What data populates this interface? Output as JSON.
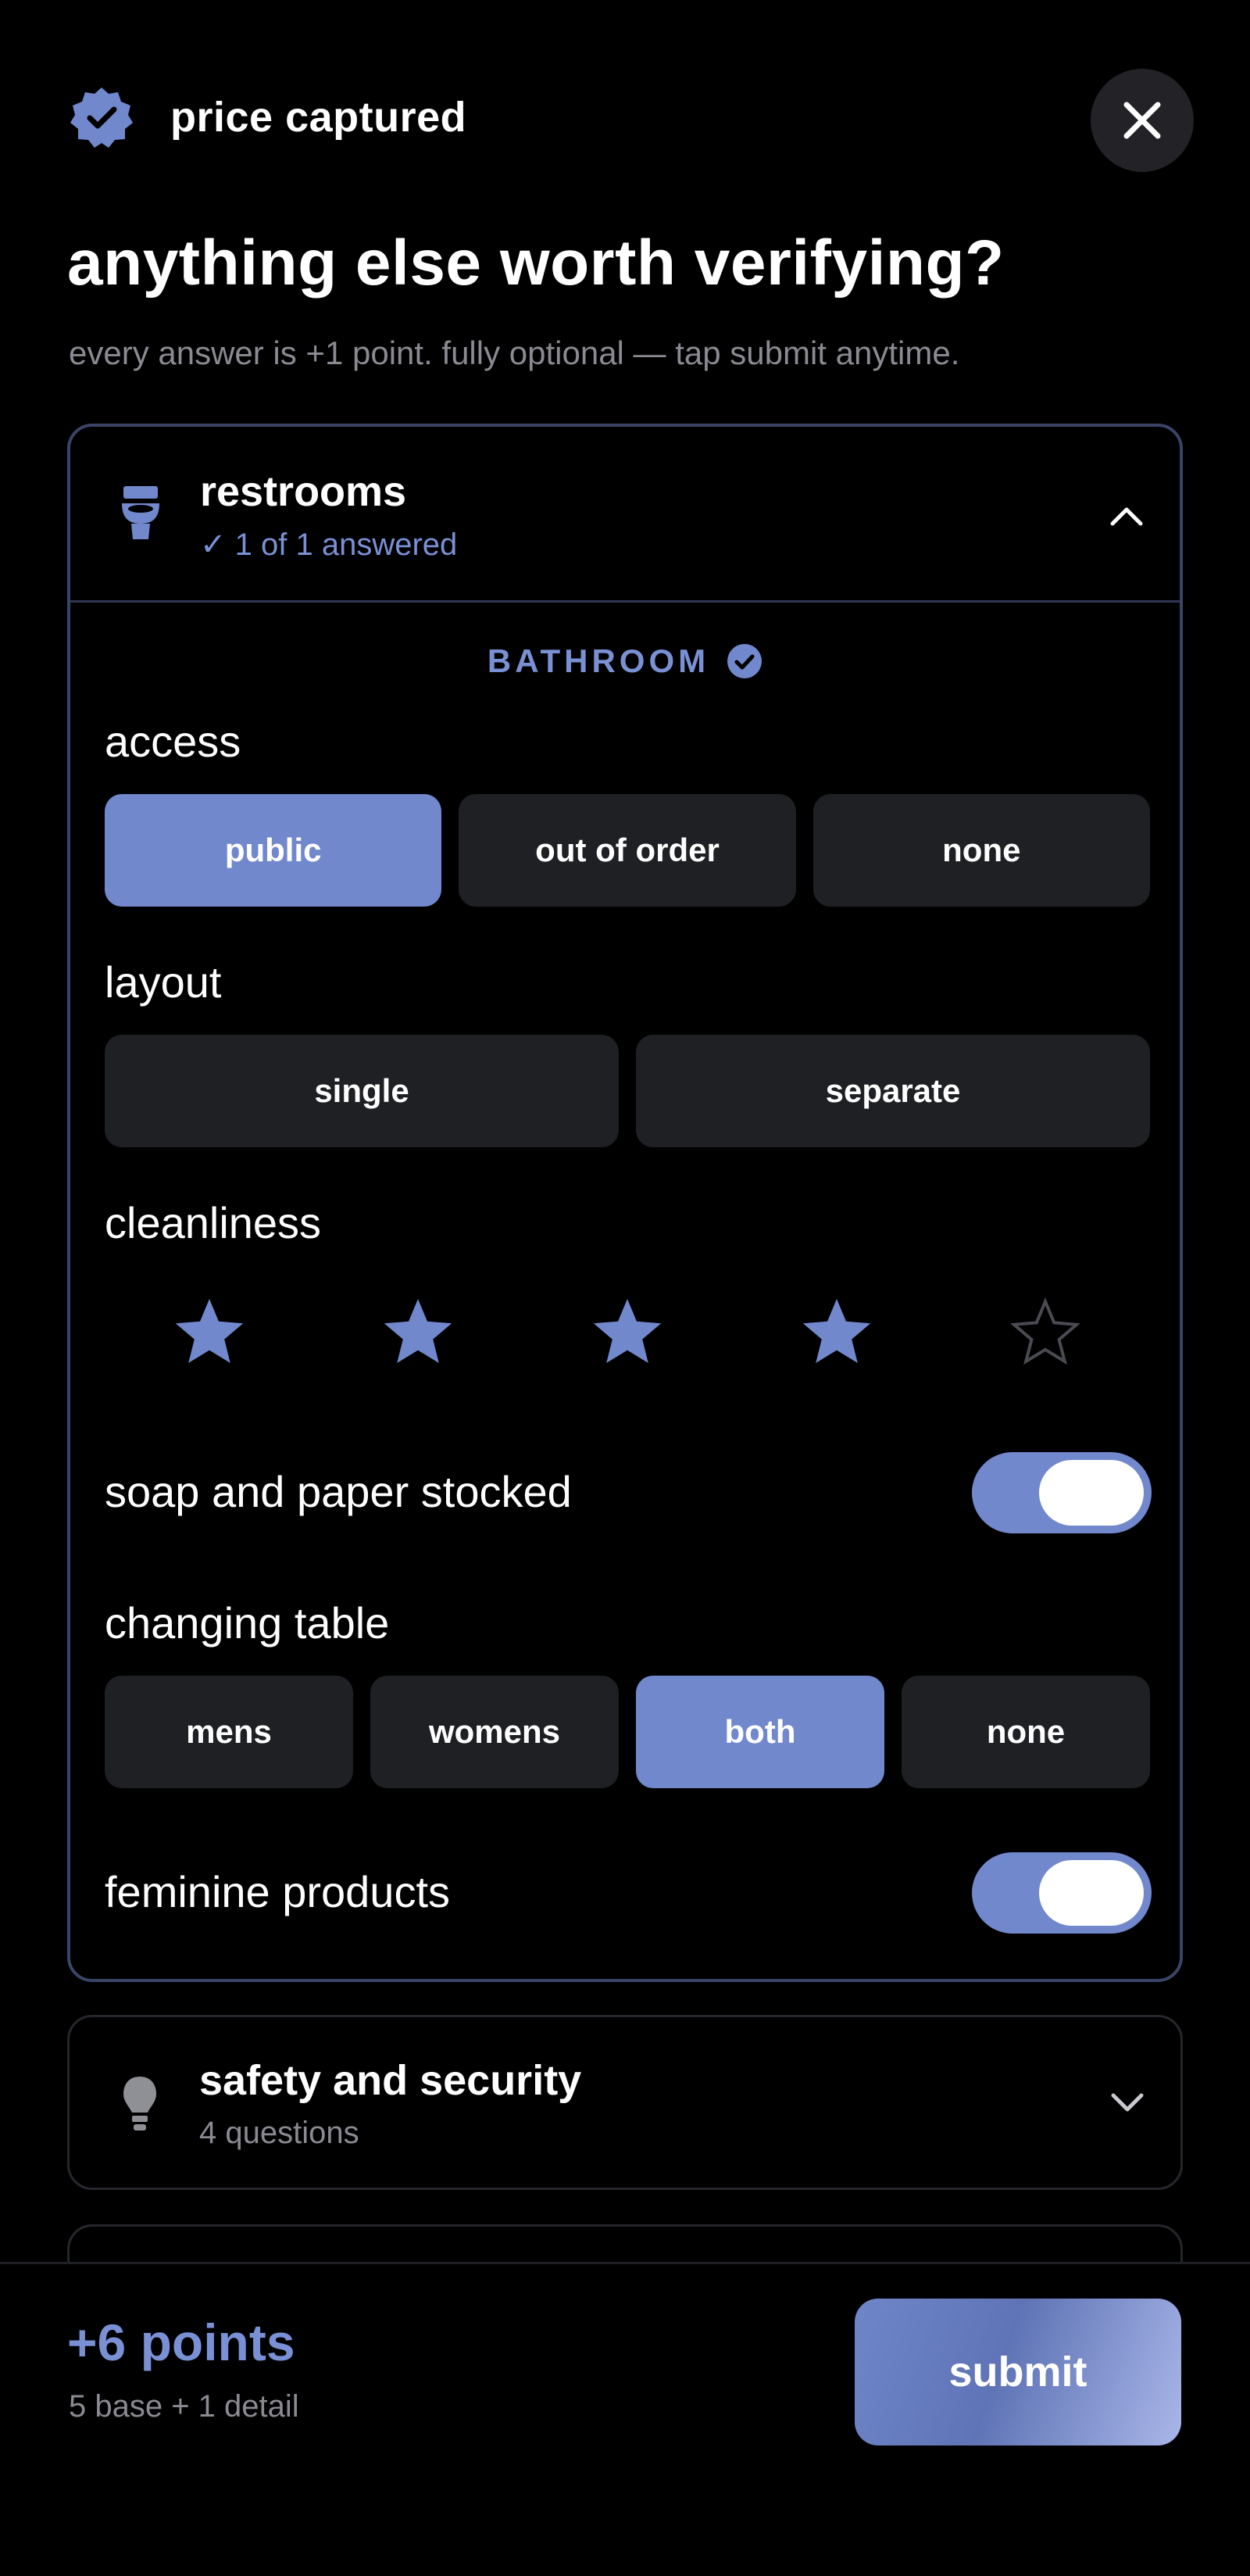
{
  "header": {
    "title": "price captured",
    "badge_icon": "verified-badge-icon",
    "close_icon": "close-icon"
  },
  "prompt": {
    "headline": "anything else worth verifying?",
    "subline": "every answer is +1 point. fully optional — tap submit anytime."
  },
  "colors": {
    "accent": "#7188cc",
    "accent_text": "#7a90d4",
    "option_bg": "#1f2024",
    "card_border": "#3a4466"
  },
  "sections": [
    {
      "title": "restrooms",
      "icon": "toilet-icon",
      "status": "✓ 1 of 1 answered",
      "expanded": true,
      "group_label": "BATHROOM",
      "questions": {
        "access": {
          "label": "access",
          "options": [
            "public",
            "out of order",
            "none"
          ],
          "selected": "public"
        },
        "layout": {
          "label": "layout",
          "options": [
            "single",
            "separate"
          ],
          "selected": null
        },
        "cleanliness": {
          "label": "cleanliness",
          "rating": 4,
          "max": 5
        },
        "soap": {
          "label": "soap and paper stocked",
          "on": true
        },
        "changing_table": {
          "label": "changing table",
          "options": [
            "mens",
            "womens",
            "both",
            "none"
          ],
          "selected": "both"
        },
        "feminine": {
          "label": "feminine products",
          "on": true
        }
      }
    },
    {
      "title": "safety and security",
      "icon": "lightbulb-icon",
      "status": "4 questions",
      "expanded": false
    }
  ],
  "footer": {
    "points": "+6 points",
    "breakdown": "5 base + 1 detail",
    "submit_label": "submit"
  }
}
